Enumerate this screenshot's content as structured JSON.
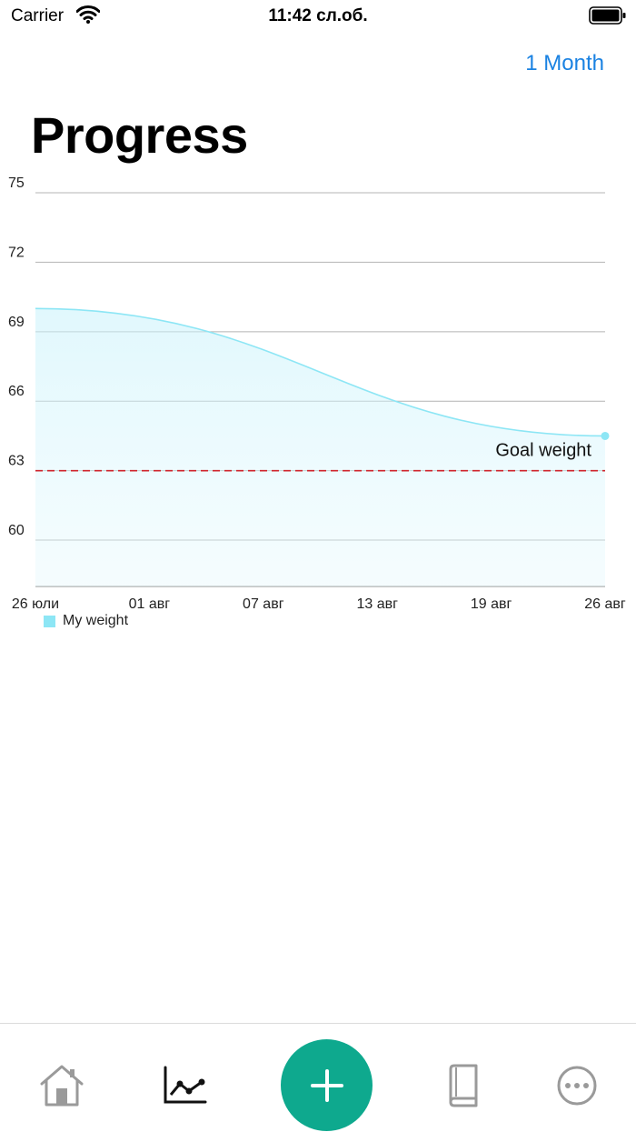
{
  "status_bar": {
    "carrier": "Carrier",
    "time": "11:42 сл.об."
  },
  "header": {
    "range_button": "1 Month",
    "title": "Progress"
  },
  "chart_data": {
    "type": "area",
    "x_labels": [
      "26 юли",
      "01 авг",
      "07 авг",
      "13 авг",
      "19 авг",
      "26 авг"
    ],
    "ylim": [
      58,
      75
    ],
    "yticks": [
      60,
      63,
      66,
      69,
      72,
      75
    ],
    "series": [
      {
        "name": "My weight",
        "color": "#8de6f5",
        "x": [
          "26 юли",
          "26 авг"
        ],
        "values": [
          70.0,
          64.5
        ]
      }
    ],
    "goal": {
      "label": "Goal weight",
      "value": 63,
      "color": "#d0242c"
    },
    "grid": true,
    "legend_position": "bottom-left"
  },
  "tab_bar": {
    "items": [
      {
        "name": "home",
        "icon": "home-icon",
        "active": false
      },
      {
        "name": "progress",
        "icon": "chart-line-icon",
        "active": true
      },
      {
        "name": "add",
        "icon": "plus-icon",
        "active": false
      },
      {
        "name": "diary",
        "icon": "book-icon",
        "active": false
      },
      {
        "name": "more",
        "icon": "ellipsis-icon",
        "active": false
      }
    ],
    "accent_color": "#0ea98e"
  }
}
